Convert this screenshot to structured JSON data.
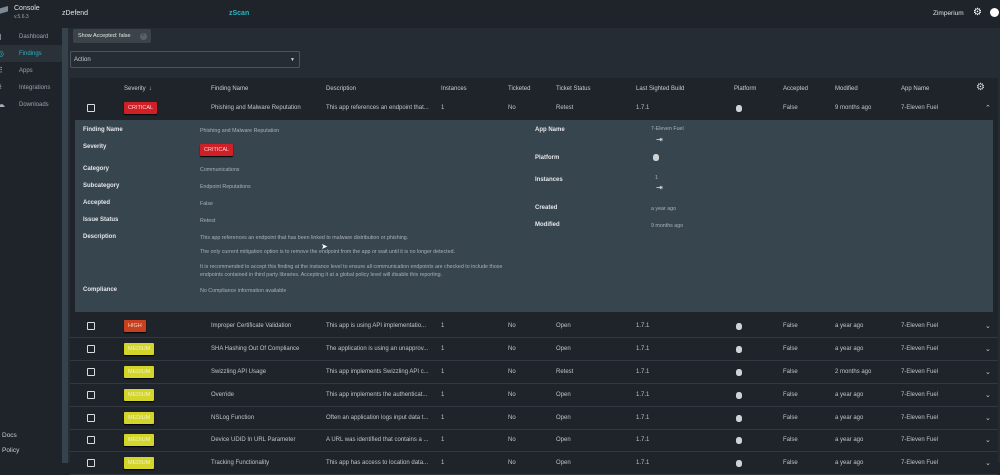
{
  "header": {
    "app_title": "Console",
    "version": "v.5.6.3",
    "product": "zDefend",
    "module": "zScan",
    "user": "Zimperium",
    "accent": "#2bb3c0"
  },
  "sidebar": {
    "items": [
      {
        "label": "Dashboard",
        "icon": "bar-chart-icon"
      },
      {
        "label": "Findings",
        "icon": "findings-icon",
        "active": true
      },
      {
        "label": "Apps",
        "icon": "grid-icon"
      },
      {
        "label": "Integrations",
        "icon": "integrations-icon"
      },
      {
        "label": "Downloads",
        "icon": "cloud-download-icon"
      }
    ],
    "bottom_items": [
      {
        "label": "Docs"
      },
      {
        "label": "Policy"
      }
    ]
  },
  "filter": {
    "chip": "Show Accepted: false"
  },
  "action": {
    "placeholder": "Action"
  },
  "table": {
    "headers": [
      "Severity",
      "Finding Name",
      "Description",
      "Instances",
      "Ticketed",
      "Ticket Status",
      "Last Sighted Build",
      "Platform",
      "Accepted",
      "Modified",
      "App Name"
    ],
    "sort_icon": "↓",
    "rows": [
      {
        "severity": "CRITICAL",
        "name": "Phishing and Malware Reputation",
        "description": "This app references an endpoint that...",
        "instances": "1",
        "ticketed": "No",
        "status": "Retest",
        "build": "1.7.1",
        "accepted": "False",
        "modified": "9 months ago",
        "app": "7-Eleven Fuel"
      },
      {
        "severity": "HIGH",
        "name": "Improper Certificate Validation",
        "description": "This app is using API implementatio...",
        "instances": "1",
        "ticketed": "No",
        "status": "Open",
        "build": "1.7.1",
        "accepted": "False",
        "modified": "a year ago",
        "app": "7-Eleven Fuel"
      },
      {
        "severity": "MEDIUM",
        "name": "SHA Hashing Out Of Compliance",
        "description": "The application is using an unapprov...",
        "instances": "1",
        "ticketed": "No",
        "status": "Open",
        "build": "1.7.1",
        "accepted": "False",
        "modified": "a year ago",
        "app": "7-Eleven Fuel"
      },
      {
        "severity": "MEDIUM",
        "name": "Swizzling API Usage",
        "description": "This app implements Swizzling API c...",
        "instances": "1",
        "ticketed": "No",
        "status": "Retest",
        "build": "1.7.1",
        "accepted": "False",
        "modified": "2 months ago",
        "app": "7-Eleven Fuel"
      },
      {
        "severity": "MEDIUM",
        "name": "Override",
        "description": "This app implements the authenticat...",
        "instances": "1",
        "ticketed": "No",
        "status": "Open",
        "build": "1.7.1",
        "accepted": "False",
        "modified": "a year ago",
        "app": "7-Eleven Fuel"
      },
      {
        "severity": "MEDIUM",
        "name": "NSLog Function",
        "description": "Often an application logs input data t...",
        "instances": "1",
        "ticketed": "No",
        "status": "Open",
        "build": "1.7.1",
        "accepted": "False",
        "modified": "a year ago",
        "app": "7-Eleven Fuel"
      },
      {
        "severity": "MEDIUM",
        "name": "Device UDID In URL Parameter",
        "description": "A URL was identified that contains a ...",
        "instances": "1",
        "ticketed": "No",
        "status": "Open",
        "build": "1.7.1",
        "accepted": "False",
        "modified": "a year ago",
        "app": "7-Eleven Fuel"
      },
      {
        "severity": "MEDIUM",
        "name": "Tracking Functionality",
        "description": "This app has access to location data...",
        "instances": "1",
        "ticketed": "No",
        "status": "Open",
        "build": "1.7.1",
        "accepted": "False",
        "modified": "a year ago",
        "app": "7-Eleven Fuel"
      }
    ]
  },
  "detail": {
    "labels": {
      "name": "Finding Name",
      "severity": "Severity",
      "category": "Category",
      "subcategory": "Subcategory",
      "accepted": "Accepted",
      "issue_status": "Issue Status",
      "description": "Description",
      "compliance": "Compliance",
      "app_name": "App Name",
      "platform": "Platform",
      "instances": "Instances",
      "created": "Created",
      "modified": "Modified"
    },
    "name": "Phishing and Malware Reputation",
    "severity": "CRITICAL",
    "category": "Communications",
    "subcategory": "Endpoint Reputations",
    "accepted": "False",
    "issue_status": "Retest",
    "description": [
      "This app references an endpoint that has been linked to malware distribution or phishing.",
      "The only current mitigation option is to remove the endpoint from the app or wait until it is no longer detected.",
      "It is recommended to accept this finding at the instance level to ensure all communication endpoints are checked to include those endpoints contained in third party libraries. Accepting it at a global policy level will disable this reporting."
    ],
    "compliance": "No Compliance information available",
    "app_name": "7-Eleven Fuel",
    "instances": "1",
    "created": "a year ago",
    "modified": "9 months ago"
  },
  "colors": {
    "critical": "#cf2027",
    "high": "#c7401f",
    "medium": "#d3d52a",
    "detail_bg": "#37454f"
  }
}
